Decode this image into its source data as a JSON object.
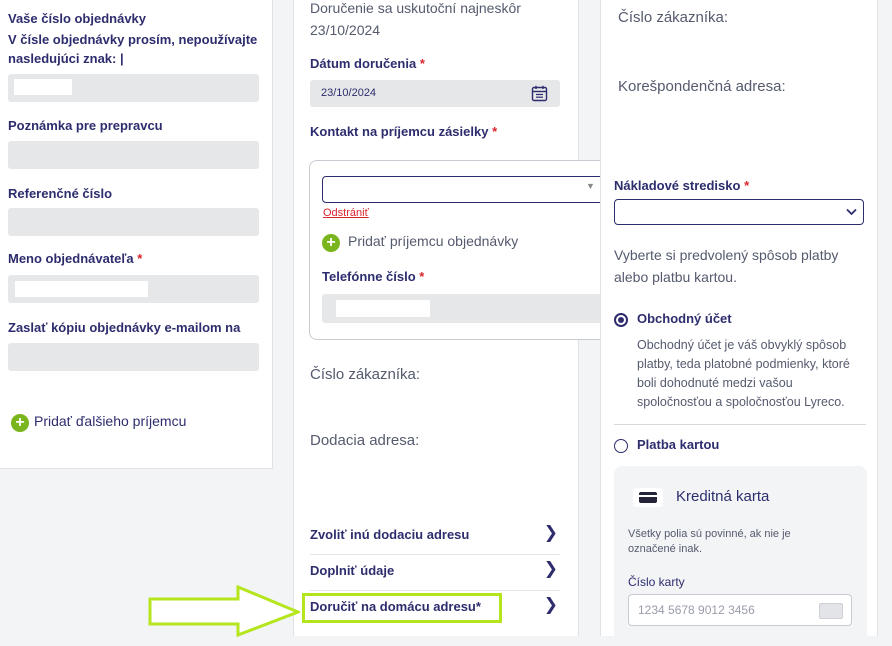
{
  "left": {
    "order_number_label": "Vaše číslo objednávky",
    "order_number_note": "V čísle objednávky prosím, nepoužívajte nasledujúci znak: |",
    "carrier_note_label": "Poznámka pre prepravcu",
    "reference_label": "Referenčné číslo",
    "orderer_name_label": "Meno objednávateľa",
    "copy_email_label": "Zaslať kópiu objednávky e-mailom na",
    "add_recipient": "Pridať ďalšieho príjemcu"
  },
  "middle": {
    "delivery_note": "Doručenie sa uskutoční najneskôr 23/10/2024",
    "delivery_date_label": "Dátum doručenia",
    "delivery_date_value": "23/10/2024",
    "contact_label": "Kontakt na príjemcu zásielky",
    "remove_link": "Odstrániť",
    "add_recipient_contact": "Pridať príjemcu objednávky",
    "phone_label": "Telefónne číslo",
    "customer_number_label": "Číslo zákazníka:",
    "delivery_address_label": "Dodacia adresa:",
    "links": [
      "Zvoliť inú dodaciu adresu",
      "Doplniť údaje",
      "Doručiť na domácu adresu*"
    ]
  },
  "right": {
    "customer_number_label": "Číslo zákazníka:",
    "correspondence_label": "Korešpondenčná adresa:",
    "cost_center_label": "Nákladové stredisko",
    "payment_intro": "Vyberte si predvolený spôsob platby alebo platbu kartou.",
    "option_account": "Obchodný účet",
    "option_account_desc": "Obchodný účet je váš obvyklý spôsob platby, teda platobné podmienky, ktoré boli dohodnuté medzi vašou spoločnosťou a spoločnosťou Lyreco.",
    "option_card": "Platba kartou",
    "card_title": "Kreditná karta",
    "card_required_note": "Všetky polia sú povinné, ak nie je označené inak.",
    "card_number_label": "Číslo karty",
    "card_number_placeholder": "1234 5678 9012 3456"
  },
  "required_mark": "*",
  "colors": {
    "navy": "#2d2d6e",
    "required": "#d9262c",
    "accent_green": "#7ab51d",
    "arrow": "#b5e61d",
    "field_bg": "#e6e7e9"
  }
}
